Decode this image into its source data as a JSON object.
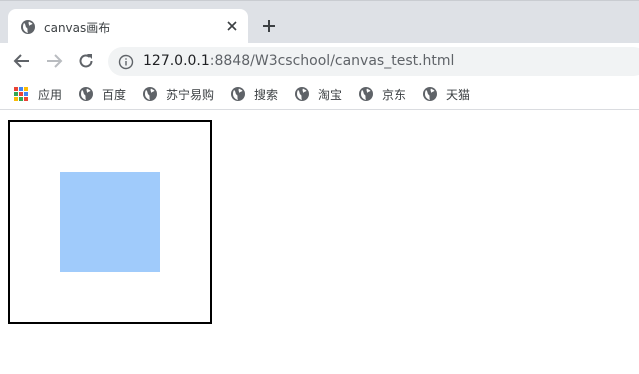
{
  "tab": {
    "title": "canvas画布",
    "favicon": "globe-icon",
    "close_icon": "close-icon",
    "new_tab_icon": "plus-icon"
  },
  "toolbar": {
    "back_icon": "arrow-left-icon",
    "forward_icon": "arrow-right-icon",
    "reload_icon": "reload-icon",
    "info_icon": "info-icon",
    "url_host": "127.0.0.1",
    "url_rest": ":8848/W3cschool/canvas_test.html"
  },
  "bookmarks": [
    {
      "label": "应用",
      "icon": "apps-grid-icon"
    },
    {
      "label": "百度",
      "icon": "globe-icon"
    },
    {
      "label": "苏宁易购",
      "icon": "globe-icon"
    },
    {
      "label": "搜索",
      "icon": "globe-icon"
    },
    {
      "label": "淘宝",
      "icon": "globe-icon"
    },
    {
      "label": "京东",
      "icon": "globe-icon"
    },
    {
      "label": "天猫",
      "icon": "globe-icon"
    }
  ],
  "canvas": {
    "border_color": "#000000",
    "fill_color": "#a0cbfb"
  },
  "colors": {
    "tabstrip": "#dee1e6",
    "omnibox": "#f1f3f4"
  }
}
